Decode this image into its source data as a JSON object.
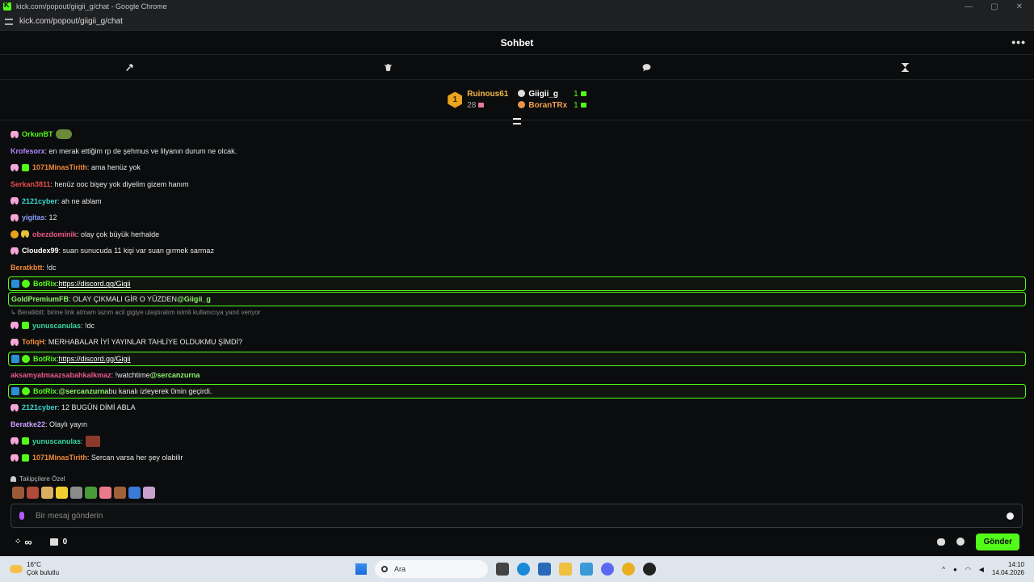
{
  "window": {
    "title": "kick.com/popout/giigii_g/chat - Google Chrome",
    "url": "kick.com/popout/giigii_g/chat"
  },
  "header": {
    "title": "Sohbet",
    "more": "•••"
  },
  "leaderboard": {
    "first": {
      "rank": "1",
      "name": "Ruinous61",
      "count": "28"
    },
    "second": {
      "name": "Giigii_g",
      "count": "1"
    },
    "third": {
      "name": "BoranTRx",
      "count": "1"
    }
  },
  "messages": [
    {
      "badges": [
        "bf"
      ],
      "user": "OrkunBT",
      "color": "#53fc18",
      "text": "",
      "emote": true
    },
    {
      "badges": [],
      "user": "Krofesorx",
      "color": "#b085ff",
      "text": ": en merak ettiğim rp de şehmus ve lilyanın durum ne olcak."
    },
    {
      "badges": [
        "bf",
        "gift"
      ],
      "user": "1071MinasTirith",
      "color": "#f08a3a",
      "text": ": ama henüz yok"
    },
    {
      "badges": [],
      "user": "Serkan3811",
      "color": "#e84a4a",
      "text": ": henüz ooc bişey yok diyelim gizem hanım"
    },
    {
      "badges": [
        "bf"
      ],
      "user": "2121cyber",
      "color": "#3ad8d0",
      "text": ": ah ne ablam"
    },
    {
      "badges": [
        "bf"
      ],
      "user": "yigitas",
      "color": "#8a9cff",
      "text": ": 12"
    },
    {
      "badges": [
        "coin",
        "goldbf"
      ],
      "user": "obezdominik",
      "color": "#e85a8a",
      "text": ": olay çok büyük herhalde"
    },
    {
      "badges": [
        "bf"
      ],
      "user": "Cloudex99",
      "color": "#ffffff",
      "text": ": suan sunucuda 11 kişi var suan gırmek sarmaz"
    },
    {
      "badges": [],
      "user": "Beratkbtt",
      "color": "#f08a3a",
      "text": ": !dc"
    },
    {
      "badges": [
        "bot",
        "ver"
      ],
      "user": "BotRix",
      "color": "#53fc18",
      "text": ": ",
      "link": "https://discord.gg/Gigii",
      "hl": true
    },
    {
      "badges": [],
      "user": "GoldPremiumFB",
      "color": "#8ff56a",
      "text": ": OLAY ÇIKMALI GİR O YÜZDEN ",
      "mention": "@Giigii_g",
      "hl": true
    },
    {
      "reply": "Beratkbtt: birine link atmam lazım acil gigiye ulaştıralım isimli kullanıcıya yanıt veriyor"
    },
    {
      "badges": [
        "bf",
        "gift"
      ],
      "user": "yunuscanulas",
      "color": "#3ad8a0",
      "text": ": !dc"
    },
    {
      "badges": [
        "bf"
      ],
      "user": "TofiqH",
      "color": "#f08a3a",
      "text": ": MERHABALAR İYİ YAYINLAR TAHLİYE OLDUKMU ŞİMDİ?"
    },
    {
      "badges": [
        "bot",
        "ver"
      ],
      "user": "BotRix",
      "color": "#53fc18",
      "text": ": ",
      "link": "https://discord.gg/Gigii",
      "hl": true
    },
    {
      "badges": [],
      "user": "aksamyatmaazsabahkalkmaz",
      "color": "#e85a8a",
      "text": ": !watchtime ",
      "mention": "@sercanzurna"
    },
    {
      "badges": [
        "bot",
        "ver"
      ],
      "user": "BotRix",
      "color": "#53fc18",
      "text": ": ",
      "mention_first": "@sercanzurna",
      "after": " bu kanalı izleyerek 0min geçirdi.",
      "hl": true
    },
    {
      "badges": [
        "bf"
      ],
      "user": "2121cyber",
      "color": "#3ad8d0",
      "text": ": 12 BUGÜN DİMİ ABLA"
    },
    {
      "badges": [],
      "user": "Beratke22",
      "color": "#c8a0ff",
      "text": ": Olaylı yayın"
    },
    {
      "badges": [
        "bf",
        "gift"
      ],
      "user": "yunuscanulas",
      "color": "#3ad8a0",
      "text": ":",
      "emote2": true
    },
    {
      "badges": [
        "bf",
        "gift"
      ],
      "user": "1071MinasTirith",
      "color": "#f08a3a",
      "text": ": Sercan varsa her şey olabilir"
    }
  ],
  "followers": {
    "label": "Takipçilere Özel"
  },
  "input": {
    "placeholder": "Bir mesaj gönderin"
  },
  "bottom": {
    "points": "∞",
    "store_count": "0",
    "send": "Gönder"
  },
  "taskbar": {
    "temp": "16°C",
    "weather": "Çok bulutlu",
    "search": "Ara",
    "time": "14:10",
    "date": "14.04.2026"
  }
}
